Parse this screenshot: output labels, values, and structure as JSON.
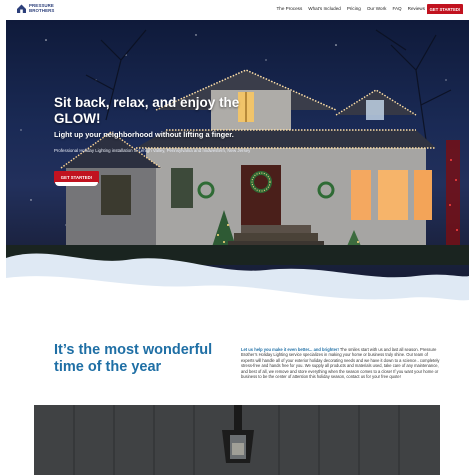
{
  "brand": {
    "line1": "PRESSURE",
    "line2": "BROTHERS",
    "color": "#2c3f7a"
  },
  "nav": {
    "items": [
      "The Process",
      "What's Included",
      "Pricing",
      "Our Work",
      "FAQ",
      "Reviews"
    ],
    "cta": "GET STARTED!"
  },
  "hero": {
    "title": "Sit back, relax, and enjoy the GLOW!",
    "subtitle": "Light up your neighborhood without lifting a finger.",
    "description": "Professional Holiday Lighting installation in Lehigh Valley, Pennsylvania and midwestern, New Jersey",
    "cta": "GET STARTED!"
  },
  "intro": {
    "heading": "It’s the most wonderful time of the year",
    "lead": "Let us help you make it even better... and brighter!",
    "body": " The smiles start with us and last all season. Pressure Brother’s Holiday Lighting service specializes in making your home or business truly shine. Our team of experts will handle all of your exterior holiday decorating needs and we have it down to a science.. completely stress-free and hands free for you. We supply all products and materials used, take care of any maintenance, and best of all, we remove and store everything when the season comes to a close! If you want your home or business to be the center of attention this holiday season, contact us for your free quote!"
  },
  "colors": {
    "accent_red": "#c1121f",
    "heading_blue": "#1f6fa5"
  }
}
